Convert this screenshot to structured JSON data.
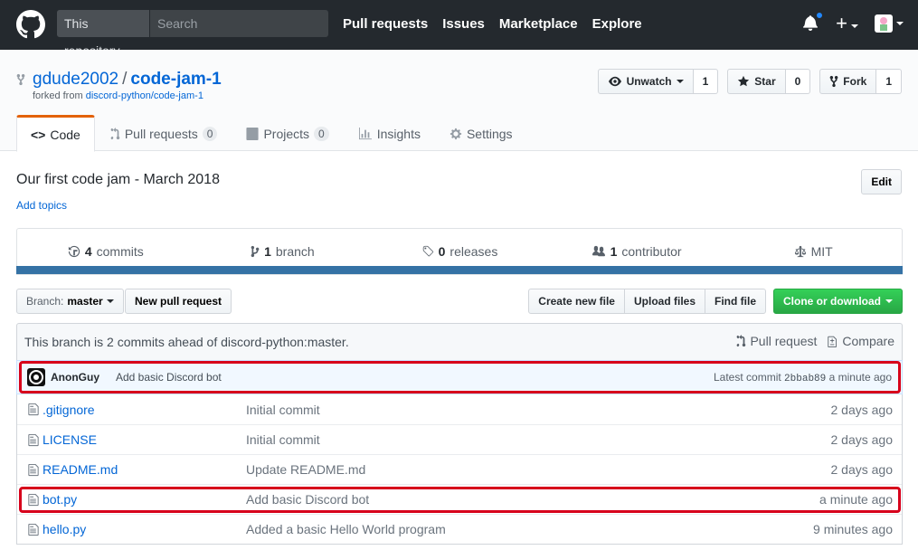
{
  "header": {
    "search_scope": "This repository",
    "search_placeholder": "Search",
    "nav": [
      "Pull requests",
      "Issues",
      "Marketplace",
      "Explore"
    ],
    "notification_dot_color": "#2188ff"
  },
  "repo": {
    "owner": "gdude2002",
    "separator": "/",
    "name": "code-jam-1",
    "forked_prefix": "forked from",
    "forked_from": "discord-python/code-jam-1",
    "actions": {
      "watch": {
        "label": "Unwatch",
        "count": "1"
      },
      "star": {
        "label": "Star",
        "count": "0"
      },
      "fork": {
        "label": "Fork",
        "count": "1"
      }
    },
    "tabs": [
      {
        "label": "Code",
        "counter": ""
      },
      {
        "label": "Pull requests",
        "counter": "0"
      },
      {
        "label": "Projects",
        "counter": "0"
      },
      {
        "label": "Insights",
        "counter": ""
      },
      {
        "label": "Settings",
        "counter": ""
      }
    ],
    "description": "Our first code jam - March 2018",
    "add_topics": "Add topics",
    "edit_label": "Edit",
    "summary": {
      "commits_num": "4",
      "commits_label": "commits",
      "branch_num": "1",
      "branch_label": "branch",
      "releases_num": "0",
      "releases_label": "releases",
      "contributor_num": "1",
      "contributor_label": "contributor",
      "license": "MIT"
    },
    "language_bar_color": "#3572a5"
  },
  "file_nav": {
    "branch_label": "Branch:",
    "branch_value": "master",
    "new_pr": "New pull request",
    "create_file": "Create new file",
    "upload_files": "Upload files",
    "find_file": "Find file",
    "clone": "Clone or download"
  },
  "branch_info": {
    "text": "This branch is 2 commits ahead of discord-python:master.",
    "pull_request": "Pull request",
    "compare": "Compare"
  },
  "latest_commit": {
    "author": "AnonGuy",
    "message": "Add basic Discord bot",
    "prefix": "Latest commit",
    "sha": "2bbab89",
    "age": "a minute ago"
  },
  "files": [
    {
      "name": ".gitignore",
      "message": "Initial commit",
      "age": "2 days ago"
    },
    {
      "name": "LICENSE",
      "message": "Initial commit",
      "age": "2 days ago"
    },
    {
      "name": "README.md",
      "message": "Update README.md",
      "age": "2 days ago"
    },
    {
      "name": "bot.py",
      "message": "Add basic Discord bot",
      "age": "a minute ago"
    },
    {
      "name": "hello.py",
      "message": "Added a basic Hello World program",
      "age": "9 minutes ago"
    }
  ],
  "highlight_color": "#d7001b"
}
